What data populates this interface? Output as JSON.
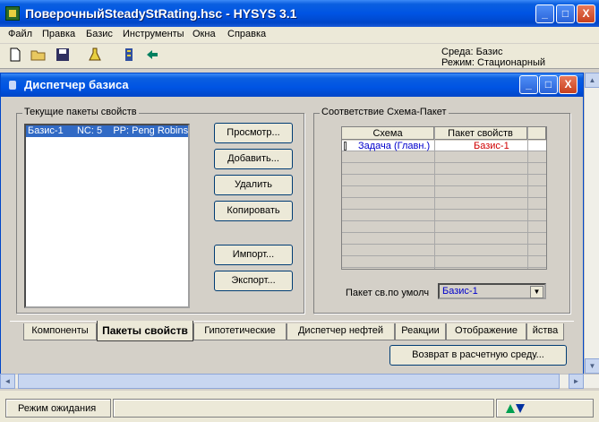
{
  "window": {
    "title": "ПоверочныйSteadyStRating.hsc - HYSYS 3.1",
    "minimize": "_",
    "maximize": "□",
    "close": "X"
  },
  "menu": [
    {
      "label": "Файл"
    },
    {
      "label": "Правка"
    },
    {
      "label": "Базис"
    },
    {
      "label": "Инструменты"
    },
    {
      "label": "Окна"
    },
    {
      "label": "Справка"
    }
  ],
  "toolbar": {
    "icons": [
      "new-file-icon",
      "open-folder-icon",
      "save-disk-icon",
      "flask-icon",
      "column-icon",
      "back-arrow-icon"
    ],
    "environment": "Среда: Базис",
    "mode": "Режим: Стационарный"
  },
  "dialog": {
    "title": "Диспетчер базиса",
    "property_packages_group": "Текущие пакеты свойств",
    "list_item": {
      "name": "Базис-1",
      "nc": "NC: 5",
      "pp": "PP: Peng Robins"
    },
    "buttons": {
      "view": "Просмотр...",
      "add": "Добавить...",
      "delete": "Удалить",
      "copy": "Копировать",
      "import": "Импорт...",
      "export": "Экспорт..."
    },
    "mapping_group": "Соответствие Схема-Пакет",
    "grid": {
      "headers": [
        "Схема",
        "Пакет свойств"
      ],
      "rows": [
        {
          "scheme": "Задача (Главн.)",
          "package": "Базис-1"
        }
      ]
    },
    "default_package_label": "Пакет св.по умолч",
    "default_package_value": "Базис-1"
  },
  "tabs": [
    {
      "label": "Компоненты",
      "active": false
    },
    {
      "label": "Пакеты свойств",
      "active": true
    },
    {
      "label": "Гипотетические",
      "active": false
    },
    {
      "label": "Диспетчер нефтей",
      "active": false
    },
    {
      "label": "Реакции",
      "active": false
    },
    {
      "label": "Отображение",
      "active": false
    },
    {
      "label": "йства",
      "active": false
    }
  ],
  "return_button": "Возврат в расчетную среду...",
  "status": {
    "text": "Режим ожидания"
  }
}
